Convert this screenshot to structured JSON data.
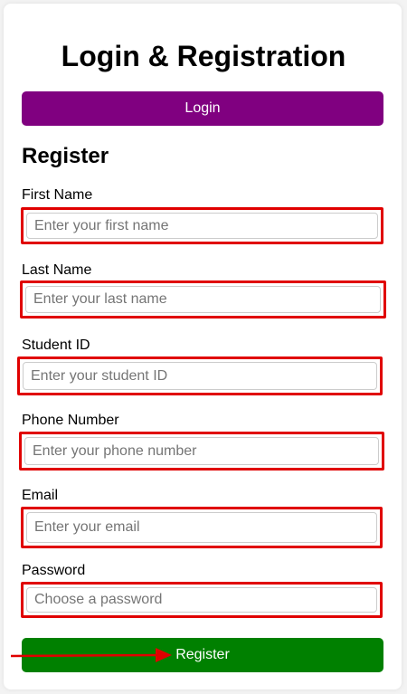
{
  "header": {
    "title": "Login & Registration"
  },
  "login_button": {
    "label": "Login"
  },
  "register_section": {
    "title": "Register",
    "fields": [
      {
        "label": "First Name",
        "placeholder": "Enter your first name",
        "value": ""
      },
      {
        "label": "Last Name",
        "placeholder": "Enter your last name",
        "value": ""
      },
      {
        "label": "Student ID",
        "placeholder": "Enter your student ID",
        "value": ""
      },
      {
        "label": "Phone Number",
        "placeholder": "Enter your phone number",
        "value": ""
      },
      {
        "label": "Email",
        "placeholder": "Enter your email",
        "value": ""
      },
      {
        "label": "Password",
        "placeholder": "Choose a password",
        "value": ""
      }
    ],
    "submit_label": "Register"
  },
  "colors": {
    "login_button": "#800080",
    "register_button": "#008000",
    "highlight": "#e00000"
  }
}
